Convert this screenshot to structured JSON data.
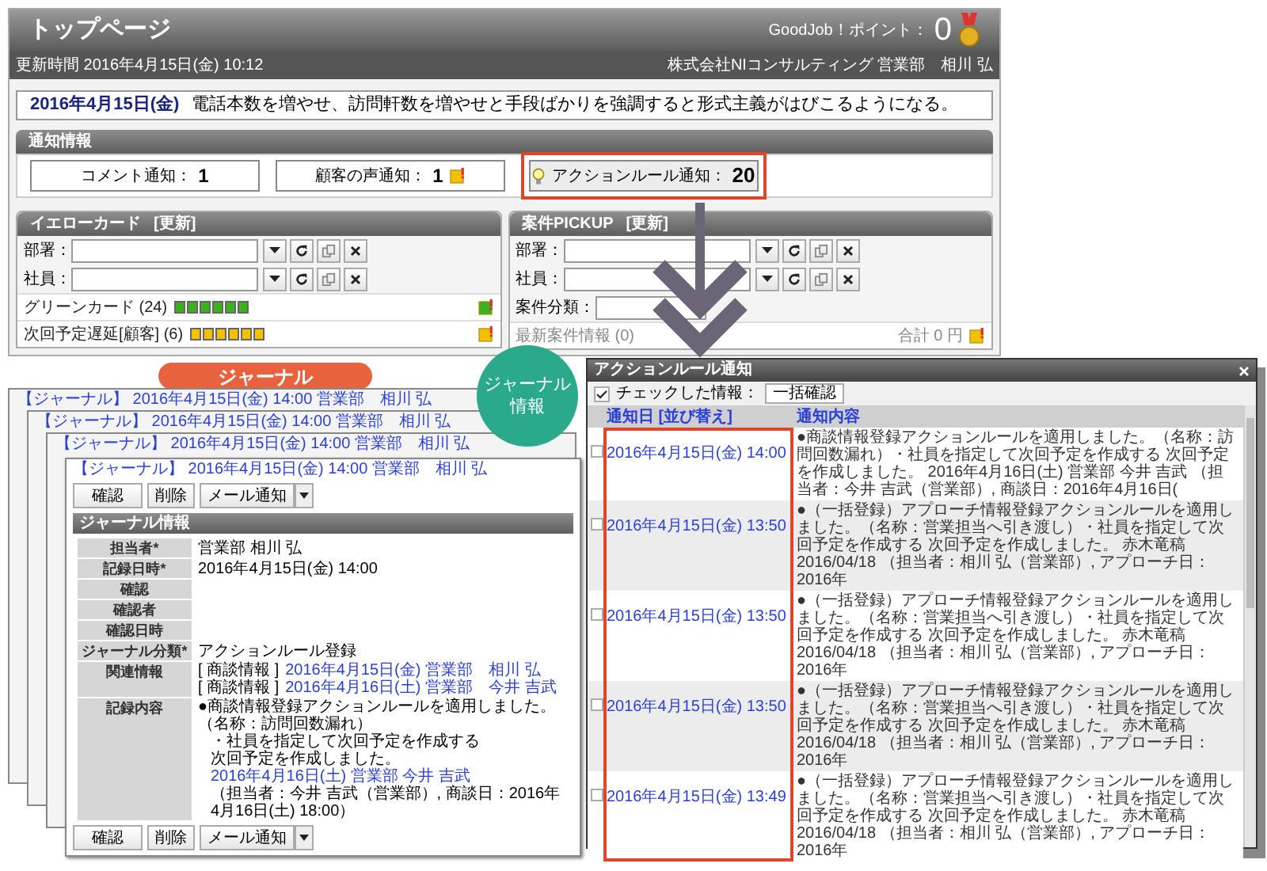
{
  "top_page": {
    "title": "トップページ",
    "points_label": "GoodJob！ポイント：",
    "points": "0",
    "updated": "更新時間 2016年4月15日(金) 10:12",
    "user": "株式会社NIコンサルティング 営業部　相川 弘",
    "message": {
      "date": "2016年4月15日(金)",
      "text": "電話本数を増やせ、訪問軒数を増やせと手段ばかりを強調すると形式主義がはびこるようになる。"
    },
    "notifications": {
      "title": "通知情報",
      "buttons": [
        {
          "label": "コメント通知：",
          "count": "1",
          "kind": "plain",
          "highlighted": false
        },
        {
          "label": "顧客の声通知：",
          "count": "1",
          "kind": "memo",
          "highlighted": false
        },
        {
          "label": "アクションルール通知：",
          "count": "20",
          "kind": "bulb",
          "highlighted": true
        }
      ]
    },
    "panels": [
      {
        "title": "イエローカード",
        "link": "[更新]",
        "fields": [
          {
            "label": "部署：",
            "kind": "picker"
          },
          {
            "label": "社員：",
            "kind": "picker"
          }
        ],
        "rows": [
          {
            "label": "グリーンカード (24)",
            "color": "#3cb01e"
          },
          {
            "label": "次回予定遅延[顧客] (6)",
            "color": "#f2c200"
          }
        ]
      },
      {
        "title": "案件PICKUP",
        "link": "[更新]",
        "fields": [
          {
            "label": "部署：",
            "kind": "picker"
          },
          {
            "label": "社員：",
            "kind": "picker"
          },
          {
            "label": "案件分類：",
            "kind": "select"
          }
        ],
        "footer": {
          "label": "最新案件情報 (0)",
          "total": "合計 0 円"
        }
      }
    ]
  },
  "journal": {
    "badge": "ジャーナル",
    "circle_label": [
      "ジャーナル",
      "情報"
    ],
    "back_cards": [
      {
        "header": "【ジャーナル】 2016年4月15日(金) 14:00 営業部　相川 弘"
      },
      {
        "header": "【ジャーナル】 2016年4月15日(金) 14:00 営業部　相川 弘"
      },
      {
        "header": "【ジャーナル】 2016年4月15日(金) 14:00 営業部　相川 弘"
      }
    ],
    "card": {
      "header": "【ジャーナル】 2016年4月15日(金) 14:00 営業部　相川 弘",
      "buttons": [
        "確認",
        "削除",
        "メール通知"
      ],
      "section": "ジャーナル情報",
      "fields": [
        {
          "label": "担当者*",
          "lines": [
            {
              "kind": "plain",
              "text": "営業部 相川 弘"
            }
          ]
        },
        {
          "label": "記録日時*",
          "lines": [
            {
              "kind": "plain",
              "text": "2016年4月15日(金) 14:00"
            }
          ]
        },
        {
          "label": "確認"
        },
        {
          "label": "確認者"
        },
        {
          "label": "確認日時"
        },
        {
          "label": "ジャーナル分類*",
          "lines": [
            {
              "kind": "plain",
              "text": "アクションルール登録"
            }
          ]
        },
        {
          "label": "関連情報",
          "lines": [
            {
              "kind": "ref",
              "tag": "[ 商談情報 ]",
              "text": "2016年4月15日(金) 営業部　相川 弘"
            },
            {
              "kind": "ref",
              "tag": "[ 商談情報 ]",
              "text": "2016年4月16日(土) 営業部　今井 吉武"
            }
          ]
        },
        {
          "label": "記録内容",
          "lines": [
            {
              "kind": "plain",
              "text": "●商談情報登録アクションルールを適用しました。（名称：訪問回数漏れ）"
            },
            {
              "kind": "indent",
              "text": "・社員を指定して次回予定を作成する"
            },
            {
              "kind": "indent",
              "text": "次回予定を作成しました。"
            },
            {
              "kind": "link",
              "text": "2016年4月16日(土) 営業部 今井 吉武"
            },
            {
              "kind": "indent",
              "text": "（担当者：今井 吉武（営業部）, 商談日：2016年4月16日(土) 18:00）"
            }
          ]
        }
      ],
      "bottom_buttons": [
        "確認",
        "削除",
        "メール通知"
      ]
    }
  },
  "dialog": {
    "title": "アクションルール通知",
    "toolbar_label": "チェックした情報：",
    "toolbar_button": "一括確認",
    "columns": [
      "通知日 [並び替え]",
      "通知内容"
    ],
    "rows": [
      {
        "checked": false,
        "date": "2016年4月15日(金) 14:00",
        "content": "●商談情報登録アクションルールを適用しました。（名称：訪問回数漏れ）・社員を指定して次回予定を作成する 次回予定を作成しました。 2016年4月16日(土) 営業部 今井 吉武 （担当者：今井 吉武（営業部）, 商談日：2016年4月16日("
      },
      {
        "checked": false,
        "date": "2016年4月15日(金) 13:50",
        "content": "●（一括登録）アプローチ情報登録アクションルールを適用しました。（名称：営業担当へ引き渡し）・社員を指定して次回予定を作成する 次回予定を作成しました。 赤木竜稿 2016/04/18 （担当者：相川 弘（営業部）, アプローチ日：2016年"
      },
      {
        "checked": false,
        "date": "2016年4月15日(金) 13:50",
        "content": "●（一括登録）アプローチ情報登録アクションルールを適用しました。（名称：営業担当へ引き渡し）・社員を指定して次回予定を作成する 次回予定を作成しました。 赤木竜稿 2016/04/18 （担当者：相川 弘（営業部）, アプローチ日：2016年"
      },
      {
        "checked": false,
        "date": "2016年4月15日(金) 13:50",
        "content": "●（一括登録）アプローチ情報登録アクションルールを適用しました。（名称：営業担当へ引き渡し）・社員を指定して次回予定を作成する 次回予定を作成しました。 赤木竜稿 2016/04/18 （担当者：相川 弘（営業部）, アプローチ日：2016年"
      },
      {
        "checked": false,
        "date": "2016年4月15日(金) 13:49",
        "content": "●（一括登録）アプローチ情報登録アクションルールを適用しました。（名称：営業担当へ引き渡し）・社員を指定して次回予定を作成する 次回予定を作成しました。 赤木竜稿 2016/04/18 （担当者：相川 弘（営業部）, アプローチ日：2016年"
      }
    ]
  }
}
